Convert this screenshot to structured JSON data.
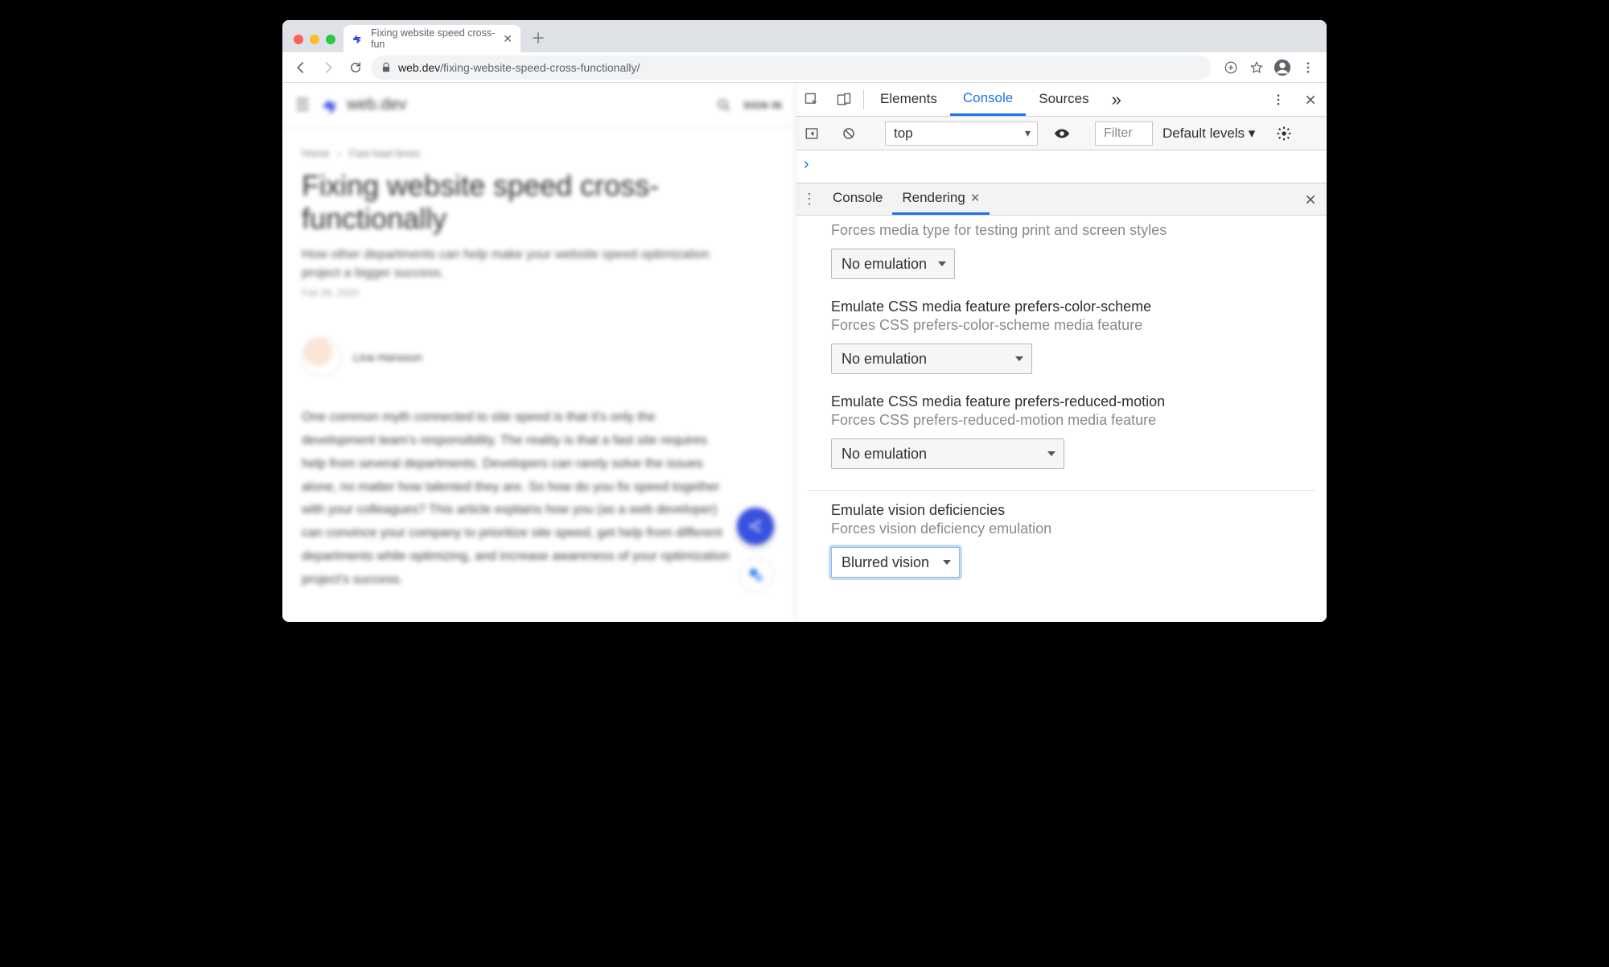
{
  "browser": {
    "tab_title": "Fixing website speed cross-fun",
    "url_domain": "web.dev",
    "url_path": "/fixing-website-speed-cross-functionally/"
  },
  "page": {
    "site_name": "web.dev",
    "signin": "SIGN IN",
    "breadcrumbs": {
      "home": "Home",
      "section": "Fast load times"
    },
    "title": "Fixing website speed cross-functionally",
    "subtitle": "How other departments can help make your website speed optimization project a bigger success.",
    "date": "Feb 28, 2020",
    "author": "Lina Hansson",
    "body": "One common myth connected to site speed is that it's only the development team's responsibility. The reality is that a fast site requires help from several departments. Developers can rarely solve the issues alone, no matter how talented they are. So how do you fix speed together with your colleagues? This article explains how you (as a web developer) can convince your company to prioritize site speed, get help from different departments while optimizing, and increase awareness of your optimization project's success."
  },
  "devtools": {
    "tabs": {
      "elements": "Elements",
      "console": "Console",
      "sources": "Sources"
    },
    "console_bar": {
      "context": "top",
      "filter_placeholder": "Filter",
      "levels": "Default levels ▾"
    },
    "drawer": {
      "tabs": {
        "console": "Console",
        "rendering": "Rendering"
      }
    },
    "rendering": {
      "media_type": {
        "desc": "Forces media type for testing print and screen styles",
        "value": "No emulation"
      },
      "color_scheme": {
        "title": "Emulate CSS media feature prefers-color-scheme",
        "desc": "Forces CSS prefers-color-scheme media feature",
        "value": "No emulation"
      },
      "reduced_motion": {
        "title": "Emulate CSS media feature prefers-reduced-motion",
        "desc": "Forces CSS prefers-reduced-motion media feature",
        "value": "No emulation"
      },
      "vision": {
        "title": "Emulate vision deficiencies",
        "desc": "Forces vision deficiency emulation",
        "value": "Blurred vision"
      }
    }
  }
}
